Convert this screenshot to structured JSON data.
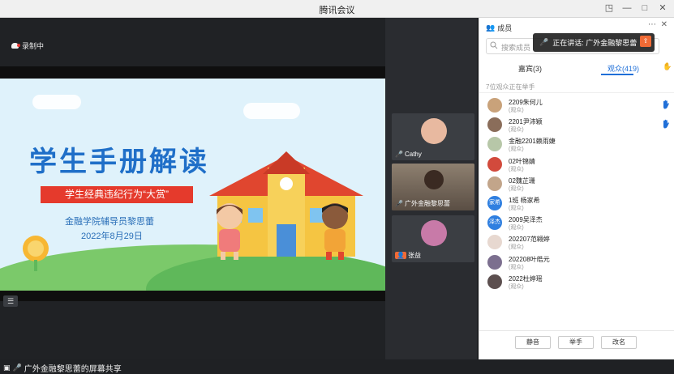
{
  "window": {
    "title": "腾讯会议"
  },
  "stage": {
    "recording": "录制中",
    "slide": {
      "title": "学生手册解读",
      "ribbon": "学生经典违纪行为“大赏”",
      "subtitle": "金融学院辅导员黎思蕾",
      "date": "2022年8月29日"
    },
    "share_label": "广外金融黎思蕾的屏幕共享"
  },
  "tiles": [
    {
      "name": "Cathy"
    },
    {
      "name": "广外金融黎思蕾"
    },
    {
      "name": "张益"
    }
  ],
  "panel": {
    "header": "成员",
    "search_placeholder": "搜索成员",
    "speaking": "正在讲话: 广外金融黎思蕾",
    "tabs": [
      {
        "label": "嘉宾(3)"
      },
      {
        "label": "观众(419)"
      }
    ],
    "notice": "7位观众正在举手",
    "participants": [
      {
        "name": "2209朱何儿",
        "role": "(观众)",
        "hand": true,
        "color": "#c9a27a"
      },
      {
        "name": "2201尹沛颖",
        "role": "(观众)",
        "hand": true,
        "color": "#8a6d5a"
      },
      {
        "name": "金融2201赖雨婕",
        "role": "(观众)",
        "hand": false,
        "color": "#b7c7a8"
      },
      {
        "name": "02叶锦婧",
        "role": "(观众)",
        "hand": false,
        "color": "#d24a3c"
      },
      {
        "name": "02魏芷珊",
        "role": "(观众)",
        "hand": false,
        "color": "#c2a58a"
      },
      {
        "name": "1班 杨家希",
        "role": "(观众)",
        "hand": false,
        "color": "#2f7fe0",
        "initials": "家希"
      },
      {
        "name": "2009吴泽杰",
        "role": "(观众)",
        "hand": false,
        "color": "#2f7fe0",
        "initials": "泽杰"
      },
      {
        "name": "202207范翱婷",
        "role": "(观众)",
        "hand": false,
        "color": "#e7d8d0"
      },
      {
        "name": "202208叶皓元",
        "role": "(观众)",
        "hand": false,
        "color": "#7c6f8f"
      },
      {
        "name": "2022杜婷瑶",
        "role": "(观众)",
        "hand": false,
        "color": "#5c4f4f"
      }
    ],
    "footer": {
      "mute": "静音",
      "raise": "举手",
      "rename": "改名"
    }
  },
  "colors": {
    "accent": "#1f6fd8",
    "slide_title": "#1f6fc8",
    "ribbon": "#e53a2c"
  }
}
